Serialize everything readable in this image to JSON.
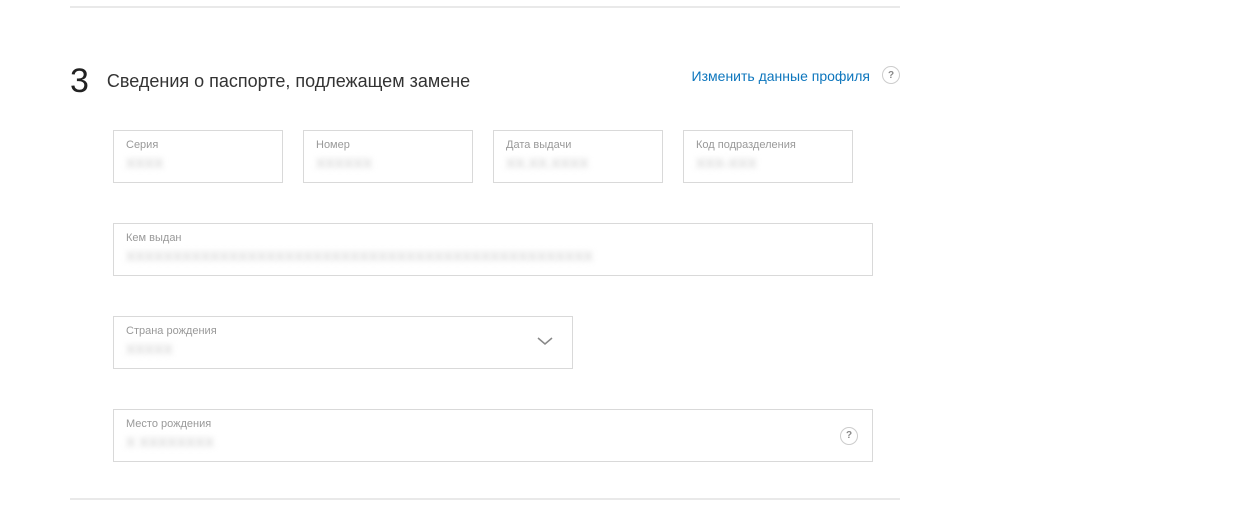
{
  "step": {
    "number": "3",
    "title": "Сведения о паспорте, подлежащем замене",
    "profile_link": "Изменить данные профиля"
  },
  "fields": {
    "series": {
      "label": "Серия",
      "value": "XXXX"
    },
    "number": {
      "label": "Номер",
      "value": "XXXXXX"
    },
    "issue_date": {
      "label": "Дата выдачи",
      "value": "XX.XX.XXXX"
    },
    "dept_code": {
      "label": "Код подразделения",
      "value": "XXX-XXX"
    },
    "issued_by": {
      "label": "Кем выдан",
      "value": "XXXXXXXXXXXXXXXXXXXXXXXXXXXXXXXXXXXXXXXXXXXXXXXXXX"
    },
    "birth_country": {
      "label": "Страна рождения",
      "value": "XXXXX"
    },
    "birth_place": {
      "label": "Место рождения",
      "value": "X XXXXXXXX"
    }
  },
  "help": "?"
}
